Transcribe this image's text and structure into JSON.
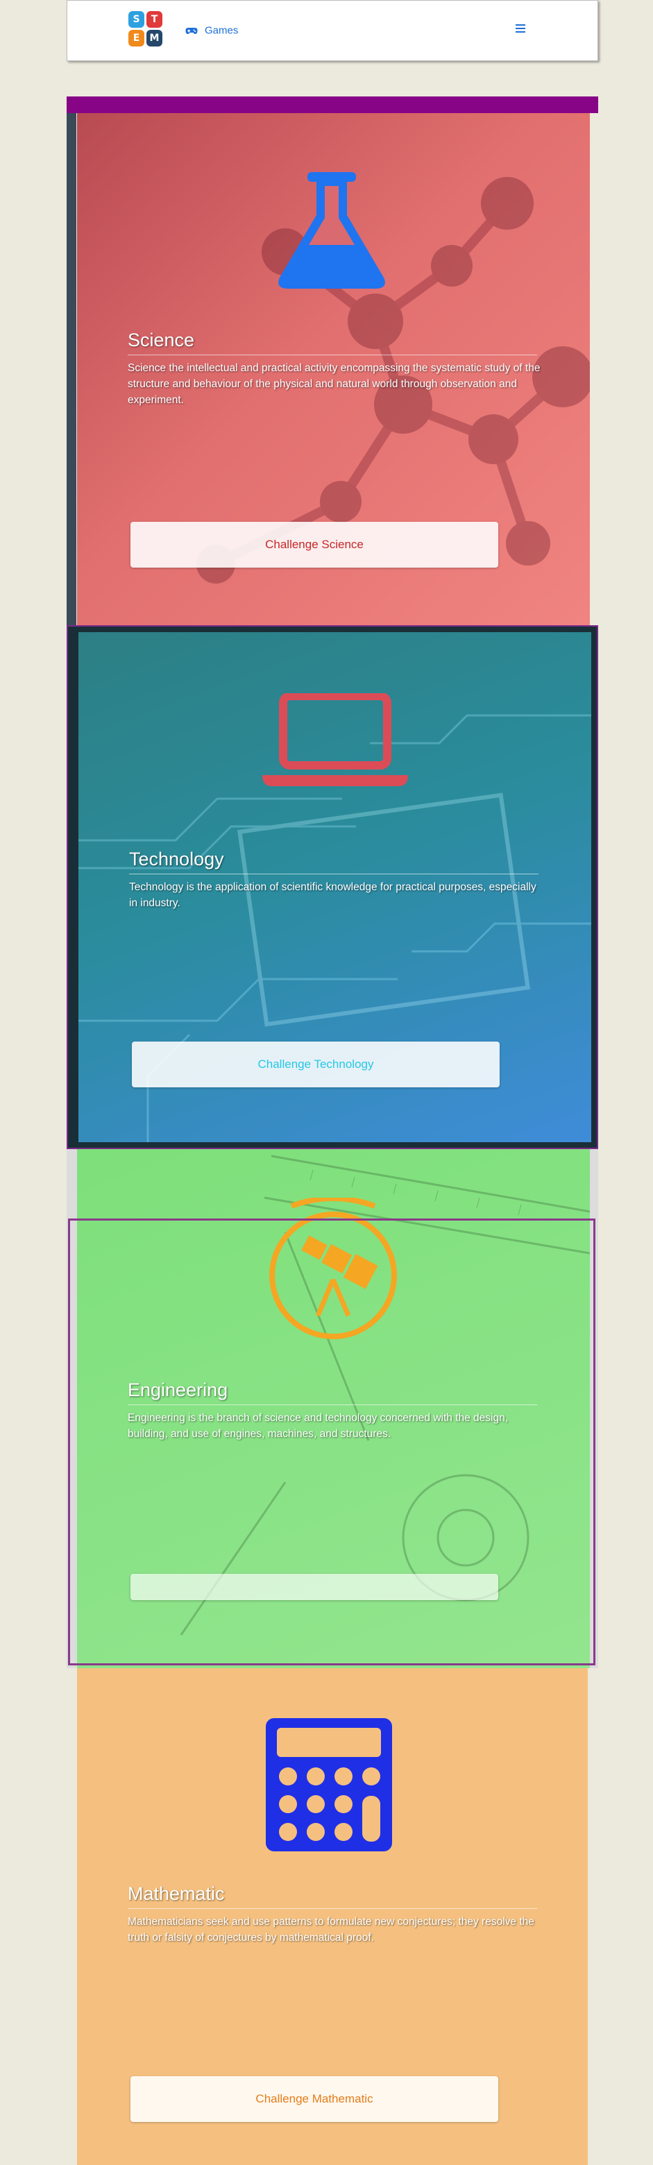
{
  "navbar": {
    "logo_letters": [
      "S",
      "T",
      "E",
      "M"
    ],
    "logo_colors": [
      "#2ea0e0",
      "#e03a3a",
      "#f08a1c",
      "#25476b"
    ],
    "games_icon": "gamepad-icon",
    "games_label": "Games",
    "menu_icon": "hamburger-icon",
    "link_color": "#1e6fd9"
  },
  "sections": {
    "science": {
      "icon": "flask-icon",
      "title": "Science",
      "description": "Science the intellectual and practical activity encompassing the systematic study of the structure and behaviour of the physical and natural world through observation and experiment.",
      "button_label": "Challenge Science",
      "accent_color": "#c62828"
    },
    "technology": {
      "icon": "laptop-icon",
      "title": "Technology",
      "description": "Technology is the application of scientific knowledge for practical purposes, especially in industry.",
      "button_label": "Challenge Technology",
      "accent_color": "#25c7e6"
    },
    "engineering": {
      "icon": "telescope-icon",
      "title": "Engineering",
      "description": "Engineering is the branch of science and technology concerned with the design, building, and use of engines, machines, and structures.",
      "button_label": "",
      "accent_color": "#f5a623"
    },
    "mathematic": {
      "icon": "calculator-icon",
      "title": "Mathematic",
      "description": "Mathematicians seek and use patterns to formulate new conjectures; they resolve the truth or falsity of conjectures by mathematical proof.",
      "button_label": "Challenge Mathematic",
      "accent_color": "#e47d1a"
    }
  }
}
